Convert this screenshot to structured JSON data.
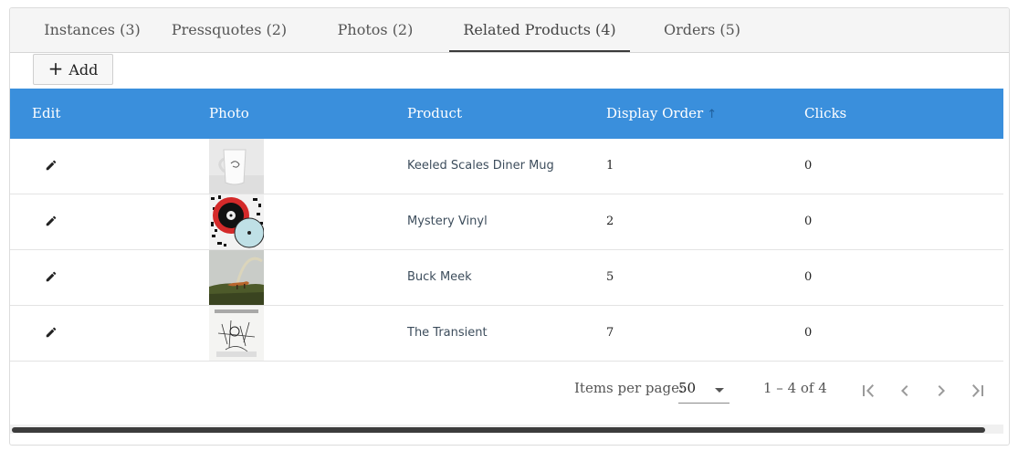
{
  "tabs": [
    {
      "label": "Instances (3)",
      "active": false
    },
    {
      "label": "Pressquotes (2)",
      "active": false
    },
    {
      "label": "Photos (2)",
      "active": false
    },
    {
      "label": "Related Products (4)",
      "active": true
    },
    {
      "label": "Orders (5)",
      "active": false
    }
  ],
  "toolbar": {
    "add_label": "Add",
    "add_icon": "plus-icon"
  },
  "table": {
    "header_color": "#3a8fdc",
    "columns": [
      "Edit",
      "Photo",
      "Product",
      "Display Order",
      "Clicks"
    ],
    "sort": {
      "column": "Display Order",
      "direction": "ascending",
      "icon": "arrow-up-icon"
    },
    "rows": [
      {
        "photo": "white-mug-photo",
        "product": "Keeled Scales Diner Mug",
        "display_order": "1",
        "clicks": "0"
      },
      {
        "photo": "vinyl-records-photo",
        "product": "Mystery Vinyl",
        "display_order": "2",
        "clicks": "0"
      },
      {
        "photo": "fox-rainbow-photo",
        "product": "Buck Meek",
        "display_order": "5",
        "clicks": "0"
      },
      {
        "photo": "sketch-album-art-photo",
        "product": "The Transient",
        "display_order": "7",
        "clicks": "0"
      }
    ]
  },
  "paginator": {
    "items_per_page_label": "Items per page:",
    "items_per_page_value": "50",
    "range_label": "1 – 4 of 4"
  }
}
